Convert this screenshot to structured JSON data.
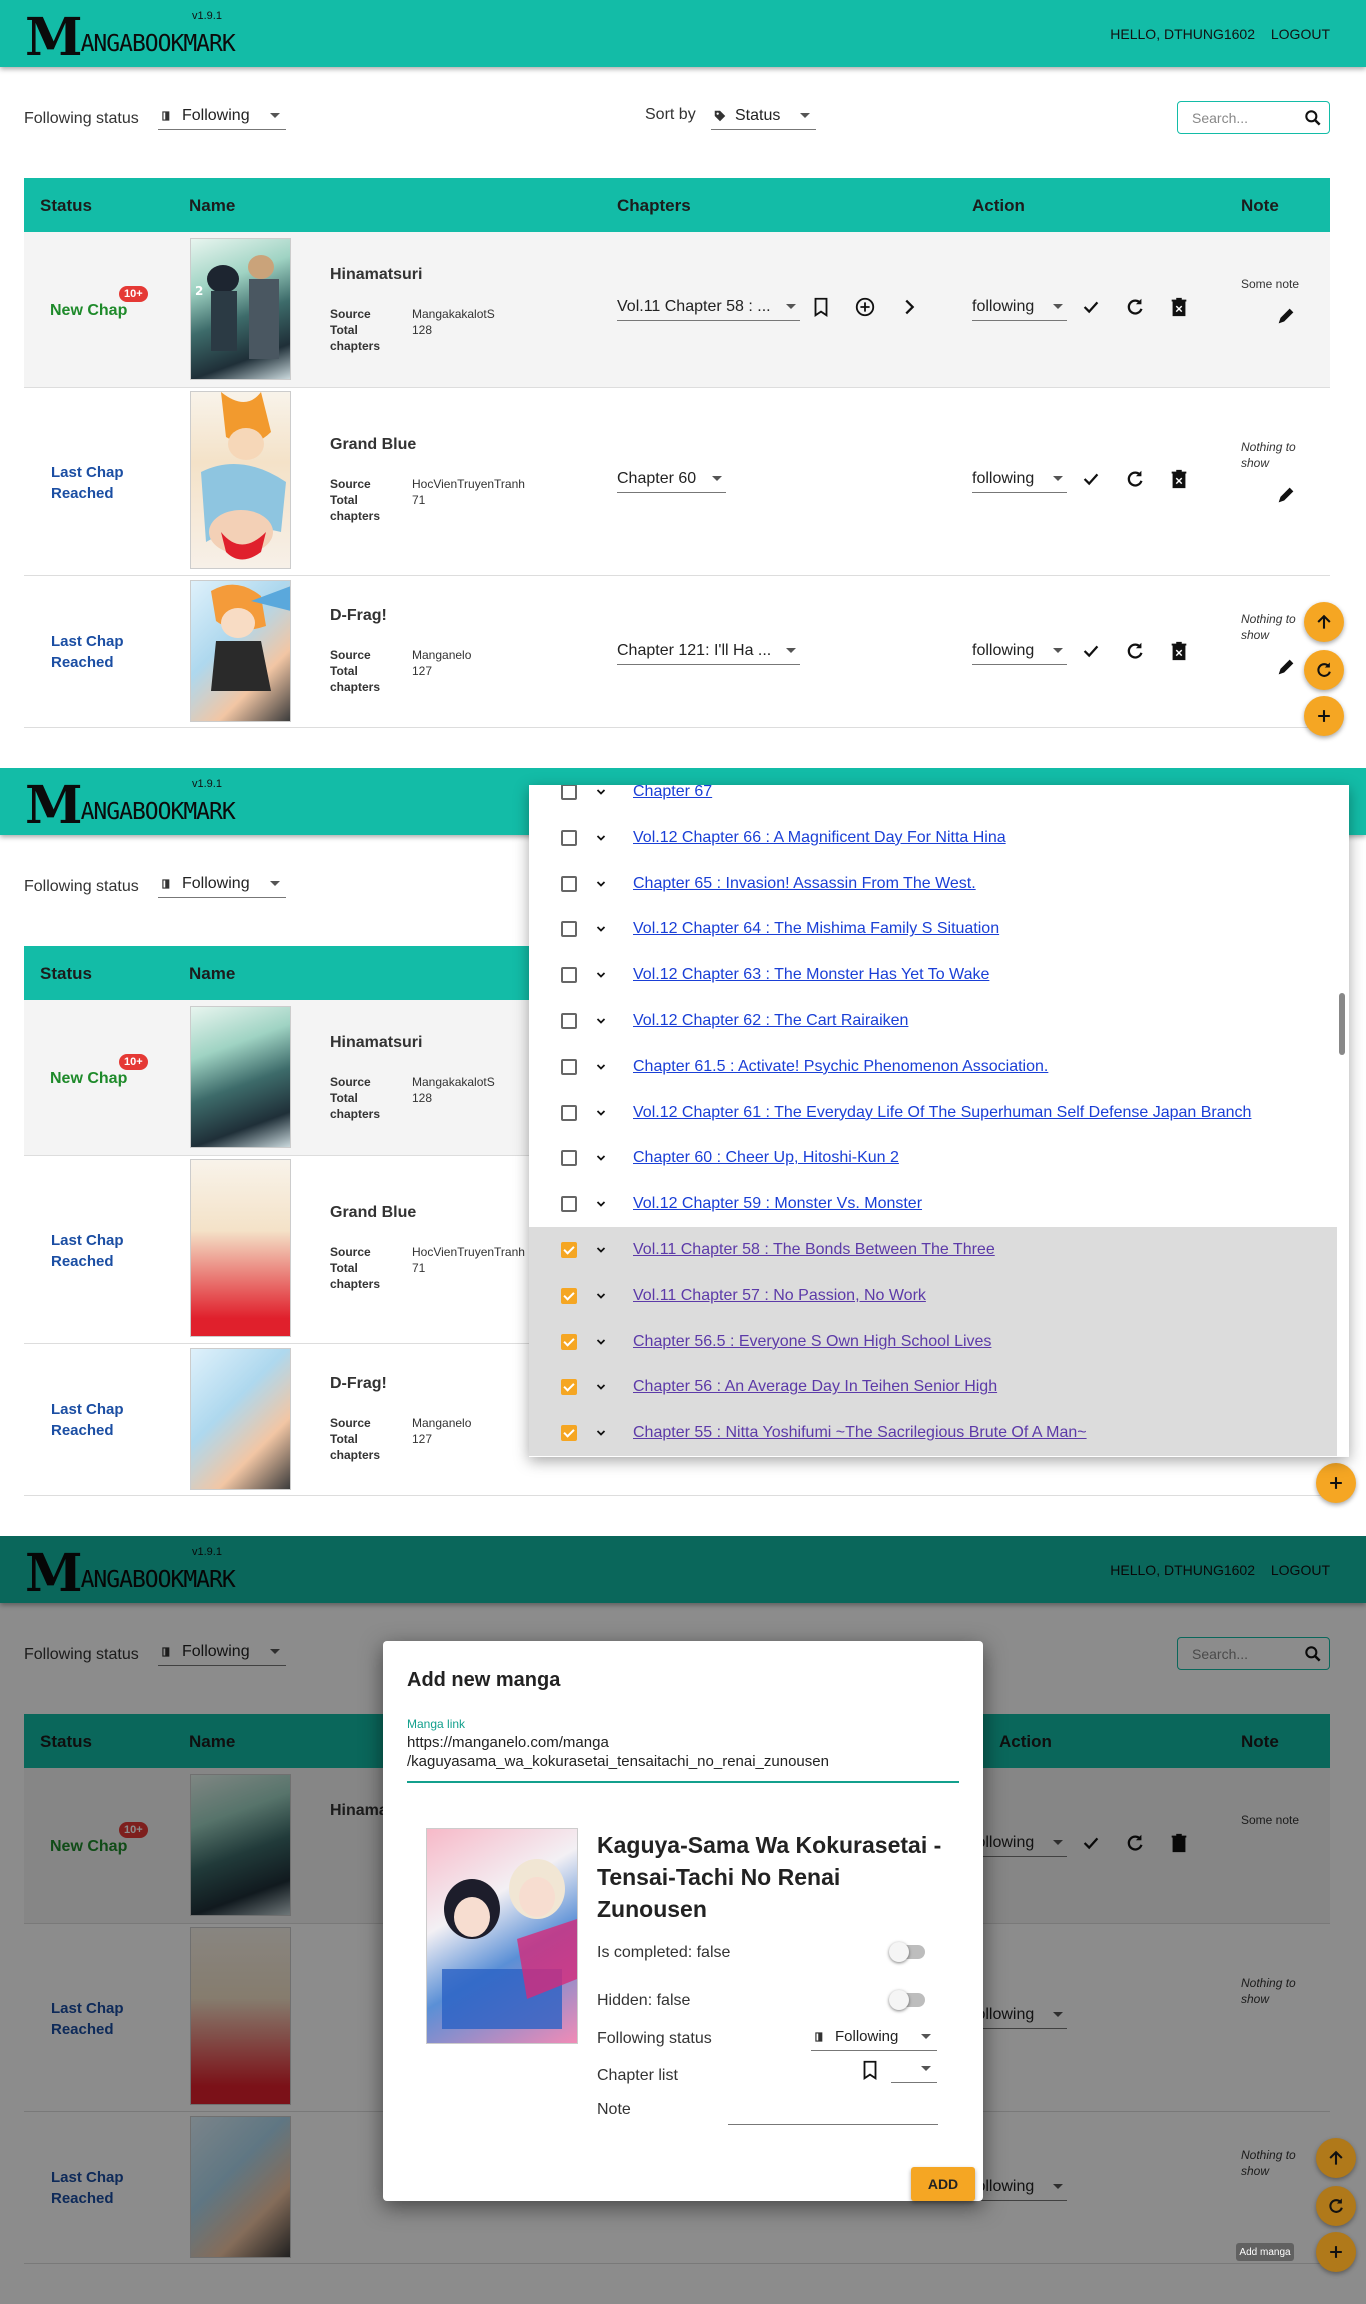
{
  "app": {
    "logo_m": "M",
    "logo_rest": "ANGABOOKMARK",
    "version": "v1.9.1",
    "greeting": "HELLO, DTHUNG1602",
    "logout": "LOGOUT",
    "accent": "#13bca7",
    "fab_color": "#f5a623"
  },
  "toolbar": {
    "following_status_label": "Following status",
    "following_status_value": "Following",
    "sort_by_label": "Sort by",
    "sort_by_value": "Status",
    "search_placeholder": "Search..."
  },
  "table": {
    "headers": {
      "status": "Status",
      "name": "Name",
      "chapters": "Chapters",
      "action": "Action",
      "note": "Note"
    },
    "rows": [
      {
        "status": "New Chap",
        "badge": "10+",
        "name": "Hinamatsuri",
        "source_label": "Source",
        "source": "MangakakalotS",
        "total_label_1": "Total",
        "total_label_2": "chapters",
        "total": "128",
        "chapter": "Vol.11 Chapter 58 : ...",
        "follow": "following",
        "note": "Some note"
      },
      {
        "status_1": "Last Chap",
        "status_2": "Reached",
        "name": "Grand Blue",
        "source_label": "Source",
        "source": "HocVienTruyenTranh",
        "total_label_1": "Total",
        "total_label_2": "chapters",
        "total": "71",
        "chapter": "Chapter 60",
        "follow": "following",
        "note_1": "Nothing to",
        "note_2": "show"
      },
      {
        "status_1": "Last Chap",
        "status_2": "Reached",
        "name": "D-Frag!",
        "source_label": "Source",
        "source": "Manganelo",
        "total_label_1": "Total",
        "total_label_2": "chapters",
        "total": "127",
        "chapter": "Chapter 121: I'll Ha ...",
        "follow": "following",
        "note_1": "Nothing to",
        "note_2": "show"
      }
    ]
  },
  "chapter_dropdown": {
    "items": [
      {
        "label": "Chapter 67",
        "checked": false
      },
      {
        "label": "Vol.12 Chapter 66 : A Magnificent Day For Nitta Hina",
        "checked": false
      },
      {
        "label": "Chapter 65 : Invasion! Assassin From The West.",
        "checked": false
      },
      {
        "label": "Vol.12 Chapter 64 : The Mishima Family S Situation",
        "checked": false
      },
      {
        "label": "Vol.12 Chapter 63 : The Monster Has Yet To Wake",
        "checked": false
      },
      {
        "label": "Vol.12 Chapter 62 : The Cart Rairaiken",
        "checked": false
      },
      {
        "label": "Chapter 61.5 : Activate! Psychic Phenomenon Association.",
        "checked": false
      },
      {
        "label": "Vol.12 Chapter 61 : The Everyday Life Of The Superhuman Self Defense Japan Branch",
        "checked": false
      },
      {
        "label": "Chapter 60 : Cheer Up, Hitoshi-Kun 2",
        "checked": false
      },
      {
        "label": "Vol.12 Chapter 59 : Monster Vs. Monster",
        "checked": false
      },
      {
        "label": "Vol.11 Chapter 58 : The Bonds Between The Three",
        "checked": true
      },
      {
        "label": "Vol.11 Chapter 57 : No Passion, No Work",
        "checked": true
      },
      {
        "label": "Chapter 56.5 : Everyone S Own High School Lives",
        "checked": true
      },
      {
        "label": "Chapter 56 : An Average Day In Teihen Senior High",
        "checked": true
      },
      {
        "label": "Chapter 55 : Nitta Yoshifumi ~The Sacrilegious Brute Of A Man~",
        "checked": true
      }
    ]
  },
  "add_modal": {
    "title": "Add new manga",
    "link_label": "Manga link",
    "link_line1": "https://manganelo.com/manga",
    "link_line2": "/kaguyasama_wa_kokurasetai_tensaitachi_no_renai_zunousen",
    "manga_name_1": "Kaguya-Sama Wa Kokurasetai -",
    "manga_name_2": "Tensai-Tachi No Renai",
    "manga_name_3": "Zunousen",
    "is_completed": "Is completed: false",
    "hidden": "Hidden: false",
    "following_status_label": "Following status",
    "following_status_value": "Following",
    "chapter_list_label": "Chapter list",
    "note_label": "Note",
    "add_button": "ADD",
    "tooltip": "Add manga"
  }
}
